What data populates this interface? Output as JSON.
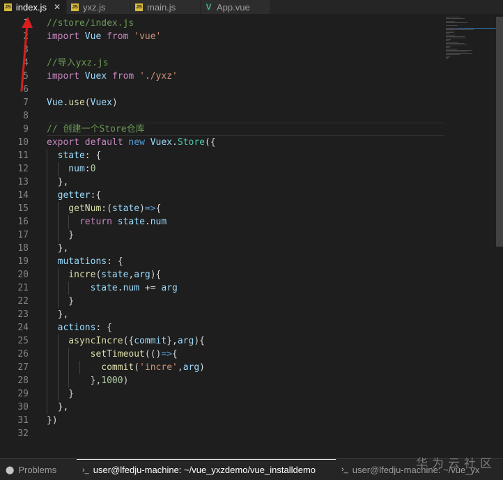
{
  "tabs": [
    {
      "label": "index.js",
      "icon": "js-file-icon",
      "icon_text": "JS",
      "active": true,
      "close": "✕"
    },
    {
      "label": "yxz.js",
      "icon": "js-file-icon",
      "icon_text": "JS",
      "active": false
    },
    {
      "label": "main.js",
      "icon": "js-file-icon",
      "icon_text": "JS",
      "active": false
    },
    {
      "label": "App.vue",
      "icon": "vue-file-icon",
      "icon_text": "V",
      "active": false
    }
  ],
  "editor": {
    "current_line": 1,
    "line_numbers": [
      "1",
      "2",
      "3",
      "4",
      "5",
      "6",
      "7",
      "8",
      "9",
      "10",
      "11",
      "12",
      "13",
      "14",
      "15",
      "16",
      "17",
      "18",
      "19",
      "20",
      "21",
      "22",
      "23",
      "24",
      "25",
      "26",
      "27",
      "28",
      "29",
      "30",
      "31",
      "32"
    ],
    "lines": [
      {
        "indent": 0,
        "tokens": [
          {
            "t": "//store/index.js",
            "k": "comment"
          }
        ]
      },
      {
        "indent": 0,
        "tokens": [
          {
            "t": "import",
            "k": "control"
          },
          {
            "t": " Vue ",
            "k": "var"
          },
          {
            "t": "from",
            "k": "control"
          },
          {
            "t": " ",
            "k": "plain"
          },
          {
            "t": "'vue'",
            "k": "string"
          }
        ]
      },
      {
        "indent": 0,
        "tokens": []
      },
      {
        "indent": 0,
        "tokens": [
          {
            "t": "//导入yxz.js",
            "k": "comment"
          }
        ]
      },
      {
        "indent": 0,
        "tokens": [
          {
            "t": "import",
            "k": "control"
          },
          {
            "t": " Vuex ",
            "k": "var"
          },
          {
            "t": "from",
            "k": "control"
          },
          {
            "t": " ",
            "k": "plain"
          },
          {
            "t": "'./yxz'",
            "k": "string"
          }
        ]
      },
      {
        "indent": 0,
        "tokens": []
      },
      {
        "indent": 0,
        "tokens": [
          {
            "t": "Vue",
            "k": "var"
          },
          {
            "t": ".",
            "k": "plain"
          },
          {
            "t": "use",
            "k": "func"
          },
          {
            "t": "(",
            "k": "plain"
          },
          {
            "t": "Vuex",
            "k": "var"
          },
          {
            "t": ")",
            "k": "plain"
          }
        ]
      },
      {
        "indent": 0,
        "tokens": []
      },
      {
        "indent": 0,
        "highlight": true,
        "tokens": [
          {
            "t": "// 创建一个Store仓库",
            "k": "comment"
          }
        ]
      },
      {
        "indent": 0,
        "tokens": [
          {
            "t": "export",
            "k": "control"
          },
          {
            "t": " ",
            "k": "plain"
          },
          {
            "t": "default",
            "k": "control"
          },
          {
            "t": " ",
            "k": "plain"
          },
          {
            "t": "new",
            "k": "keyword"
          },
          {
            "t": " Vuex",
            "k": "var"
          },
          {
            "t": ".",
            "k": "plain"
          },
          {
            "t": "Store",
            "k": "class"
          },
          {
            "t": "({",
            "k": "plain"
          }
        ]
      },
      {
        "indent": 1,
        "tokens": [
          {
            "t": "  state",
            "k": "var"
          },
          {
            "t": ": {",
            "k": "plain"
          }
        ]
      },
      {
        "indent": 2,
        "tokens": [
          {
            "t": "    num",
            "k": "var"
          },
          {
            "t": ":",
            "k": "plain"
          },
          {
            "t": "0",
            "k": "number"
          }
        ]
      },
      {
        "indent": 1,
        "tokens": [
          {
            "t": "  },",
            "k": "plain"
          }
        ]
      },
      {
        "indent": 1,
        "tokens": [
          {
            "t": "  getter",
            "k": "var"
          },
          {
            "t": ":{",
            "k": "plain"
          }
        ]
      },
      {
        "indent": 2,
        "tokens": [
          {
            "t": "    getNum",
            "k": "func"
          },
          {
            "t": ":(",
            "k": "plain"
          },
          {
            "t": "state",
            "k": "var"
          },
          {
            "t": ")",
            "k": "plain"
          },
          {
            "t": "=>",
            "k": "keyword"
          },
          {
            "t": "{",
            "k": "plain"
          }
        ]
      },
      {
        "indent": 3,
        "tokens": [
          {
            "t": "      ",
            "k": "plain"
          },
          {
            "t": "return",
            "k": "control"
          },
          {
            "t": " state",
            "k": "var"
          },
          {
            "t": ".",
            "k": "plain"
          },
          {
            "t": "num",
            "k": "var"
          }
        ]
      },
      {
        "indent": 2,
        "tokens": [
          {
            "t": "    }",
            "k": "plain"
          }
        ]
      },
      {
        "indent": 1,
        "tokens": [
          {
            "t": "  },",
            "k": "plain"
          }
        ]
      },
      {
        "indent": 1,
        "tokens": [
          {
            "t": "  mutations",
            "k": "var"
          },
          {
            "t": ": {",
            "k": "plain"
          }
        ]
      },
      {
        "indent": 2,
        "tokens": [
          {
            "t": "    incre",
            "k": "func"
          },
          {
            "t": "(",
            "k": "plain"
          },
          {
            "t": "state",
            "k": "var"
          },
          {
            "t": ",",
            "k": "plain"
          },
          {
            "t": "arg",
            "k": "var"
          },
          {
            "t": "){",
            "k": "plain"
          }
        ]
      },
      {
        "indent": 3,
        "tokens": [
          {
            "t": "        state",
            "k": "var"
          },
          {
            "t": ".",
            "k": "plain"
          },
          {
            "t": "num",
            "k": "var"
          },
          {
            "t": " += ",
            "k": "plain"
          },
          {
            "t": "arg",
            "k": "var"
          }
        ]
      },
      {
        "indent": 2,
        "tokens": [
          {
            "t": "    }",
            "k": "plain"
          }
        ]
      },
      {
        "indent": 1,
        "tokens": [
          {
            "t": "  },",
            "k": "plain"
          }
        ]
      },
      {
        "indent": 1,
        "tokens": [
          {
            "t": "  actions",
            "k": "var"
          },
          {
            "t": ": {",
            "k": "plain"
          }
        ]
      },
      {
        "indent": 2,
        "tokens": [
          {
            "t": "    asyncIncre",
            "k": "func"
          },
          {
            "t": "({",
            "k": "plain"
          },
          {
            "t": "commit",
            "k": "var"
          },
          {
            "t": "},",
            "k": "plain"
          },
          {
            "t": "arg",
            "k": "var"
          },
          {
            "t": "){",
            "k": "plain"
          }
        ]
      },
      {
        "indent": 3,
        "tokens": [
          {
            "t": "        setTimeout",
            "k": "func"
          },
          {
            "t": "(()",
            "k": "plain"
          },
          {
            "t": "=>",
            "k": "keyword"
          },
          {
            "t": "{",
            "k": "plain"
          }
        ]
      },
      {
        "indent": 4,
        "tokens": [
          {
            "t": "          commit",
            "k": "func"
          },
          {
            "t": "(",
            "k": "plain"
          },
          {
            "t": "'incre'",
            "k": "string"
          },
          {
            "t": ",",
            "k": "plain"
          },
          {
            "t": "arg",
            "k": "var"
          },
          {
            "t": ")",
            "k": "plain"
          }
        ]
      },
      {
        "indent": 3,
        "tokens": [
          {
            "t": "        },",
            "k": "plain"
          },
          {
            "t": "1000",
            "k": "number"
          },
          {
            "t": ")",
            "k": "plain"
          }
        ]
      },
      {
        "indent": 2,
        "tokens": [
          {
            "t": "    }",
            "k": "plain"
          }
        ]
      },
      {
        "indent": 1,
        "tokens": [
          {
            "t": "  },",
            "k": "plain"
          }
        ]
      },
      {
        "indent": 0,
        "tokens": [
          {
            "t": "})",
            "k": "plain"
          }
        ]
      },
      {
        "indent": 0,
        "tokens": []
      }
    ]
  },
  "panel": {
    "tabs": [
      {
        "label": "Problems",
        "icon": "problems-icon",
        "glyph": "⬤",
        "active": false
      },
      {
        "label": "user@lfedju-machine: ~/vue_yxzdemo/vue_installdemo",
        "icon": "terminal-icon",
        "glyph": "›_",
        "active": true
      },
      {
        "label": "user@lfedju-machine: ~/vue_yx",
        "icon": "terminal-icon",
        "glyph": "›_",
        "active": false
      }
    ]
  },
  "watermark": "华为云社区",
  "colors": {
    "accent": "#3a77b7",
    "annotation_arrow": "#d81e1e",
    "editor_bg": "#1e1e1e"
  }
}
